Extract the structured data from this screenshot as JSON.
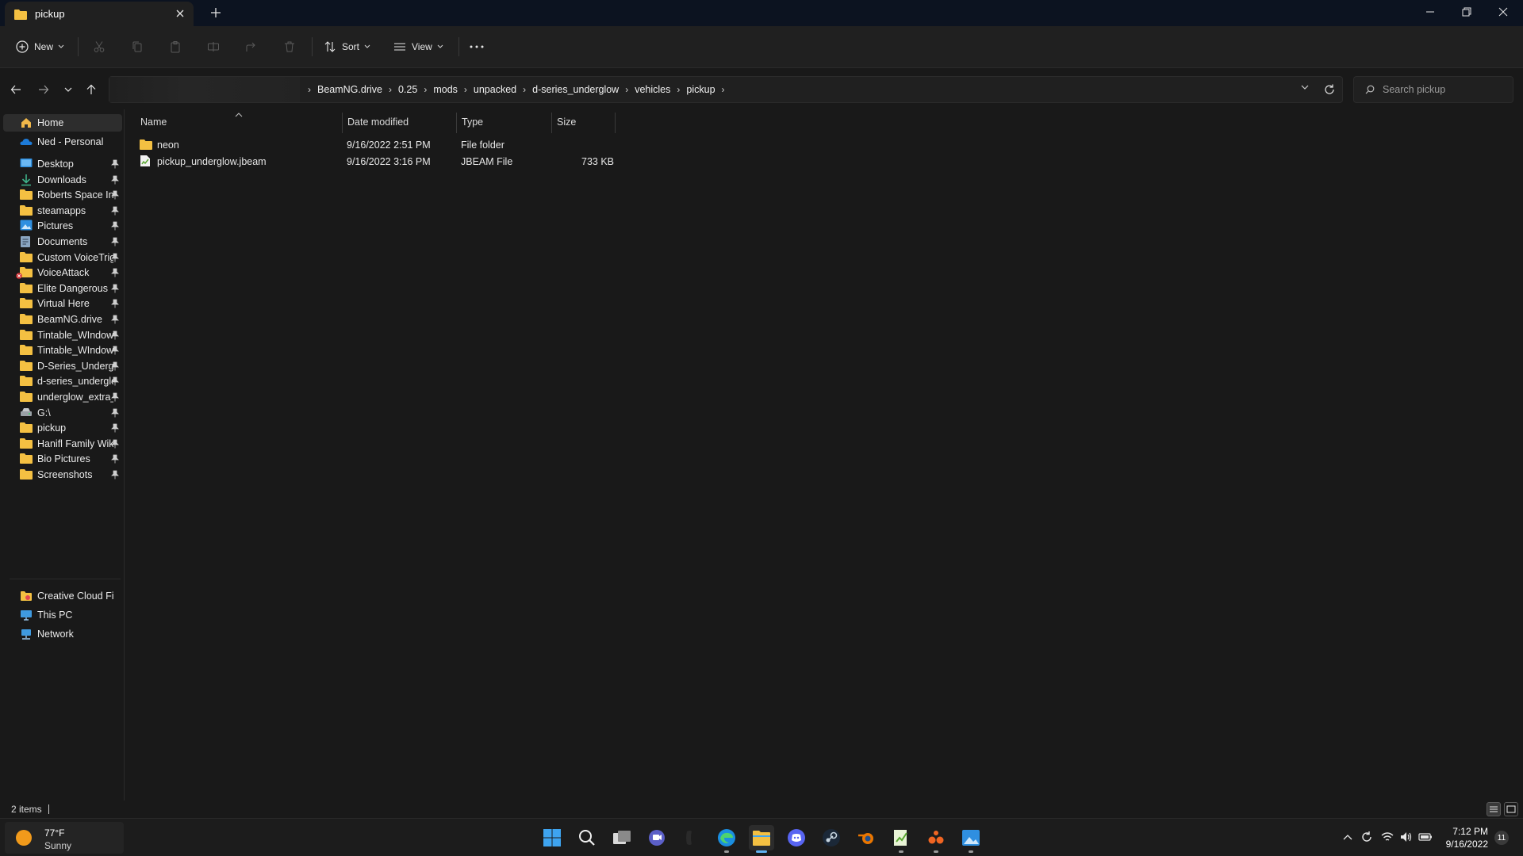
{
  "window": {
    "tab_title": "pickup"
  },
  "toolbar": {
    "new_label": "New",
    "sort_label": "Sort",
    "view_label": "View"
  },
  "address": {
    "breadcrumbs": [
      "BeamNG.drive",
      "0.25",
      "mods",
      "unpacked",
      "d-series_underglow",
      "vehicles",
      "pickup"
    ],
    "search_placeholder": "Search pickup"
  },
  "sidebar": {
    "top_items": [
      {
        "label": "Home",
        "icon": "home-icon"
      },
      {
        "label": "Ned - Personal",
        "icon": "onedrive-cloud-icon"
      }
    ],
    "quick_access": [
      {
        "label": "Desktop",
        "icon": "desktop-icon"
      },
      {
        "label": "Downloads",
        "icon": "downloads-icon"
      },
      {
        "label": "Roberts Space Industries",
        "icon": "folder-icon"
      },
      {
        "label": "steamapps",
        "icon": "folder-icon"
      },
      {
        "label": "Pictures",
        "icon": "pictures-icon"
      },
      {
        "label": "Documents",
        "icon": "documents-icon"
      },
      {
        "label": "Custom VoiceTriggers",
        "icon": "folder-icon"
      },
      {
        "label": "VoiceAttack",
        "icon": "folder-icon"
      },
      {
        "label": "Elite Dangerous",
        "icon": "folder-icon"
      },
      {
        "label": "Virtual Here",
        "icon": "folder-icon"
      },
      {
        "label": "BeamNG.drive",
        "icon": "folder-icon"
      },
      {
        "label": "Tintable_WIndows",
        "icon": "folder-icon"
      },
      {
        "label": "Tintable_WIndows",
        "icon": "folder-icon"
      },
      {
        "label": "D-Series_Underglow",
        "icon": "folder-icon"
      },
      {
        "label": "d-series_underglow",
        "icon": "folder-icon"
      },
      {
        "label": "underglow_extra_",
        "icon": "folder-icon"
      },
      {
        "label": "G:\\",
        "icon": "drive-icon"
      },
      {
        "label": "pickup",
        "icon": "folder-icon"
      },
      {
        "label": "Hanifl Family Wiki",
        "icon": "folder-icon"
      },
      {
        "label": "Bio Pictures",
        "icon": "folder-icon"
      },
      {
        "label": "Screenshots",
        "icon": "folder-icon"
      }
    ],
    "bottom_items": [
      {
        "label": "Creative Cloud Files",
        "icon": "creative-cloud-icon"
      },
      {
        "label": "This PC",
        "icon": "this-pc-icon"
      },
      {
        "label": "Network",
        "icon": "network-icon"
      }
    ]
  },
  "columns": {
    "name": "Name",
    "date": "Date modified",
    "type": "Type",
    "size": "Size"
  },
  "files": [
    {
      "name": "neon",
      "date": "9/16/2022 2:51 PM",
      "type": "File folder",
      "size": "",
      "icon": "folder-icon"
    },
    {
      "name": "pickup_underglow.jbeam",
      "date": "9/16/2022 3:16 PM",
      "type": "JBEAM File",
      "size": "733 KB",
      "icon": "file-icon"
    }
  ],
  "status": {
    "item_count": "2 items"
  },
  "taskbar": {
    "weather_temp": "77°F",
    "weather_condition": "Sunny",
    "time": "7:12 PM",
    "date": "9/16/2022",
    "notification_count": "11"
  },
  "colors": {
    "accent": "#5fb2f2",
    "folder": "#f4c042",
    "background": "#191919",
    "titlebar": "#0c1320"
  }
}
